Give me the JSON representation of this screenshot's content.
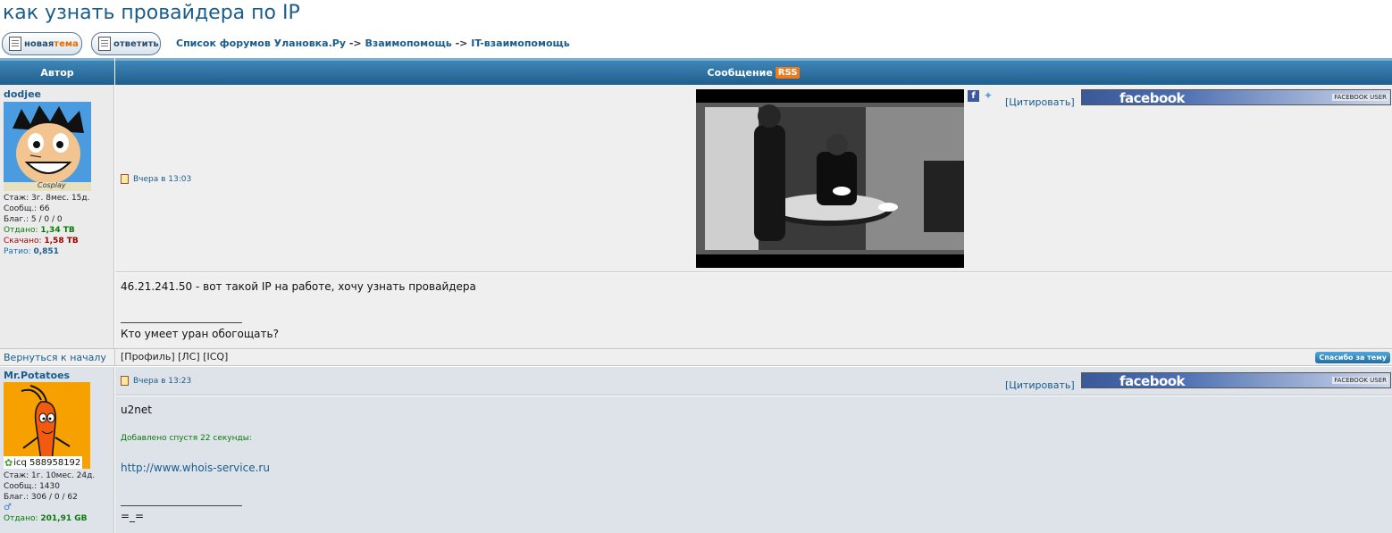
{
  "page": {
    "title": "как узнать провайдера по IP"
  },
  "toolbar": {
    "new_topic": {
      "prefix": "новая",
      "suffix": "тема"
    },
    "reply_label": "ответить",
    "crumbs": [
      "Список форумов Улановка.Ру",
      "Взаимопомощь",
      "IT-взаимопомощь"
    ],
    "sep": "->"
  },
  "table": {
    "author_header": "Автор",
    "message_header": "Сообщение",
    "rss_label": "RSS"
  },
  "posts": [
    {
      "username": "dodjee",
      "avatar_caption": "Cosplay",
      "stats": {
        "stazh": "Стаж: 3г. 8мес. 15д.",
        "posts": "Сообщ.: 66",
        "blag": "Благ.: 5 / 0 / 0",
        "given_label": "Отдано:",
        "given": "1,34 ТВ",
        "down_label": "Скачано:",
        "down": "1,58 ТВ",
        "ratio_label": "Ратио:",
        "ratio": "0,851"
      },
      "time": "Вчера в 13:03",
      "cite": "[Цитировать]",
      "facebook": "facebook",
      "facebook_user": "FACEBOOK USER",
      "body": "46.21.241.50 - вот такой IP на работе, хочу узнать провайдера",
      "signature": "Кто умеет уран обогощать?",
      "back_to_top": "Вернуться к началу",
      "profile_links": [
        "[Профиль]",
        "[ЛС]",
        "[ICQ]"
      ],
      "thanks_button": "Спасибо за тему"
    },
    {
      "username": "Mr.Potatoes",
      "icq": "icq 588958192",
      "stats": {
        "stazh": "Стаж: 1г. 10мес. 24д.",
        "posts": "Сообщ.: 1430",
        "blag": "Благ.: 306 / 0 / 62",
        "given_label": "Отдано:",
        "given": "201,91 GB"
      },
      "time": "Вчера в 13:23",
      "cite": "[Цитировать]",
      "facebook": "facebook",
      "facebook_user": "FACEBOOK USER",
      "body": "u2net",
      "added": "Добавлено спустя 22 секунды:",
      "link": "http://www.whois-service.ru",
      "signature": "=_="
    }
  ],
  "colors": {
    "accent": "#1a5d8c",
    "header": "#2a6c9c",
    "orange": "#f07b1a"
  }
}
